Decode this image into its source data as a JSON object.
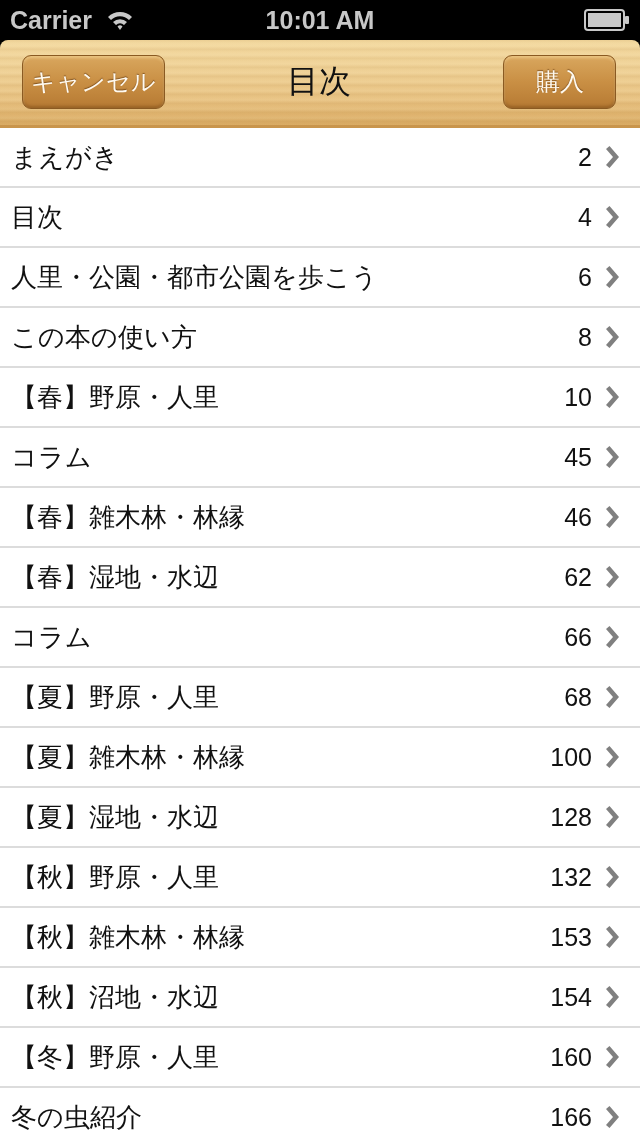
{
  "status_bar": {
    "carrier": "Carrier",
    "time": "10:01 AM"
  },
  "nav_bar": {
    "title": "目次",
    "left_button": "キャンセル",
    "right_button": "購入"
  },
  "toc": [
    {
      "title": "まえがき",
      "page": "2"
    },
    {
      "title": "目次",
      "page": "4"
    },
    {
      "title": "人里・公園・都市公園を歩こう",
      "page": "6"
    },
    {
      "title": "この本の使い方",
      "page": "8"
    },
    {
      "title": "【春】野原・人里",
      "page": "10"
    },
    {
      "title": "コラム",
      "page": "45"
    },
    {
      "title": "【春】雑木林・林縁",
      "page": "46"
    },
    {
      "title": "【春】湿地・水辺",
      "page": "62"
    },
    {
      "title": "コラム",
      "page": "66"
    },
    {
      "title": "【夏】野原・人里",
      "page": "68"
    },
    {
      "title": "【夏】雑木林・林縁",
      "page": "100"
    },
    {
      "title": "【夏】湿地・水辺",
      "page": "128"
    },
    {
      "title": "【秋】野原・人里",
      "page": "132"
    },
    {
      "title": "【秋】雑木林・林縁",
      "page": "153"
    },
    {
      "title": "【秋】沼地・水辺",
      "page": "154"
    },
    {
      "title": "【冬】野原・人里",
      "page": "160"
    },
    {
      "title": "冬の虫紹介",
      "page": "166"
    }
  ]
}
